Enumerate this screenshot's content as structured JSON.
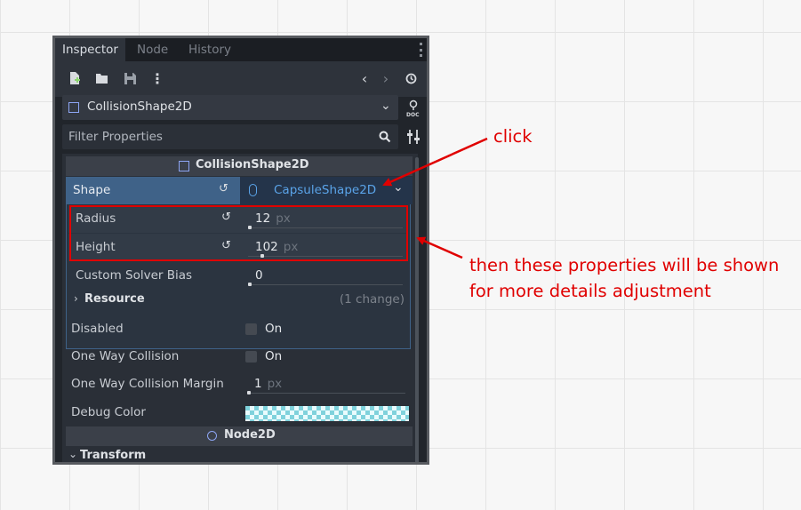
{
  "tabs": [
    "Inspector",
    "Node",
    "History"
  ],
  "object_selector": {
    "label": "CollisionShape2D"
  },
  "filter": {
    "placeholder": "Filter Properties"
  },
  "section_header": "CollisionShape2D",
  "shape": {
    "label": "Shape",
    "value": "CapsuleShape2D"
  },
  "subresource_props": [
    {
      "label": "Radius",
      "value": "12",
      "unit": "px"
    },
    {
      "label": "Height",
      "value": "102",
      "unit": "px"
    },
    {
      "label": "Custom Solver Bias",
      "value": "0",
      "unit": ""
    }
  ],
  "resource_group": {
    "label": "Resource",
    "changes": "(1 change)"
  },
  "props": [
    {
      "label": "Disabled",
      "value": "On"
    },
    {
      "label": "One Way Collision",
      "value": "On"
    },
    {
      "label": "One Way Collision Margin",
      "value": "1",
      "unit": "px"
    },
    {
      "label": "Debug Color"
    }
  ],
  "node2d_header": "Node2D",
  "transform_group": "Transform",
  "annotations": {
    "click": "click",
    "note_line1": "then these properties will be shown",
    "note_line2": "for more details adjustment"
  },
  "colors": {
    "annotation": "#e00000",
    "selection": "#3f6288",
    "link": "#5aa3e8"
  }
}
